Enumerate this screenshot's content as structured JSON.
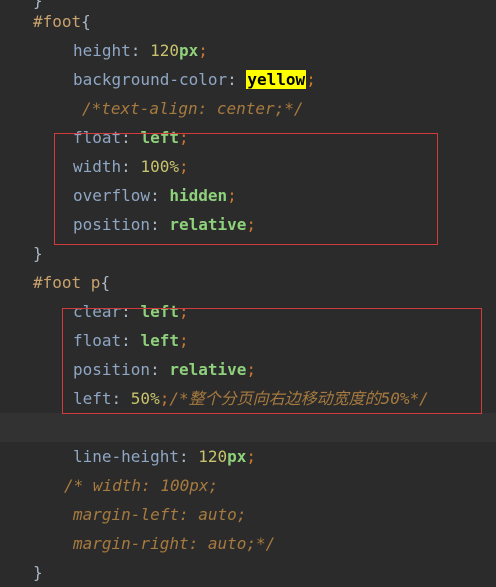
{
  "code": {
    "top_fragment": "}",
    "rule1_selector": "#foot",
    "rule1_open": "{",
    "l_height_prop": "height",
    "l_height_num": "120",
    "l_height_unit": "px",
    "l_bg_prop": "background-color",
    "l_bg_val": "yellow",
    "l_comment_textalign": "/*text-align: center;*/",
    "l_float_prop": "float",
    "l_float_val": "left",
    "l_width_prop": "width",
    "l_width_num": "100%",
    "l_overflow_prop": "overflow",
    "l_overflow_val": "hidden",
    "l_position_prop": "position",
    "l_position_val": "relative",
    "rule1_close": "}",
    "rule2_selector": "#foot p",
    "rule2_open": "{",
    "l_clear_prop": "clear",
    "l_clear_val": "left",
    "l_float2_prop": "float",
    "l_float2_val": "left",
    "l_position2_prop": "position",
    "l_position2_val": "relative",
    "l_left_prop": "left",
    "l_left_num": "50%",
    "l_left_comment": "/*整个分页向右边移动宽度的50%*/",
    "l_lineheight_prop": "line-height",
    "l_lineheight_num": "120",
    "l_lineheight_unit": "px",
    "l_comment_width": "/* width: 100px;",
    "l_comment_marginleft": "margin-left: auto;",
    "l_comment_marginright": "margin-right: auto;*/",
    "rule2_close": "}"
  },
  "colors": {
    "background": "#2b2b2b",
    "current_line": "#323232",
    "highlight_box": "#d23b3b",
    "color_swatch": "#ffff00"
  }
}
